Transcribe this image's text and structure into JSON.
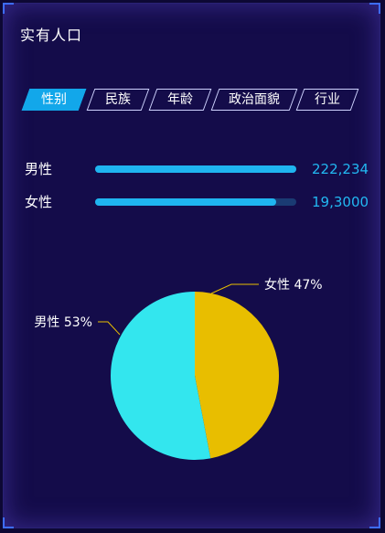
{
  "panel": {
    "title": "实有人口"
  },
  "tabs": [
    {
      "label": "性别",
      "active": true
    },
    {
      "label": "民族",
      "active": false
    },
    {
      "label": "年龄",
      "active": false
    },
    {
      "label": "政治面貌",
      "active": false
    },
    {
      "label": "行业",
      "active": false
    }
  ],
  "bars": [
    {
      "label": "男性",
      "value_text": "222,234",
      "fill_fraction": 1.0
    },
    {
      "label": "女性",
      "value_text": "19,3000",
      "fill_fraction": 0.9
    }
  ],
  "colors": {
    "male": "#33e6ee",
    "female": "#e8be00",
    "bar": "#1fb5f0",
    "track": "#1a3b73",
    "accent": "#12a7ea"
  },
  "chart_data": {
    "type": "pie",
    "slices": [
      {
        "name": "女性",
        "value": 47,
        "label": "女性 47%"
      },
      {
        "name": "男性",
        "value": 53,
        "label": "男性 53%"
      }
    ]
  }
}
